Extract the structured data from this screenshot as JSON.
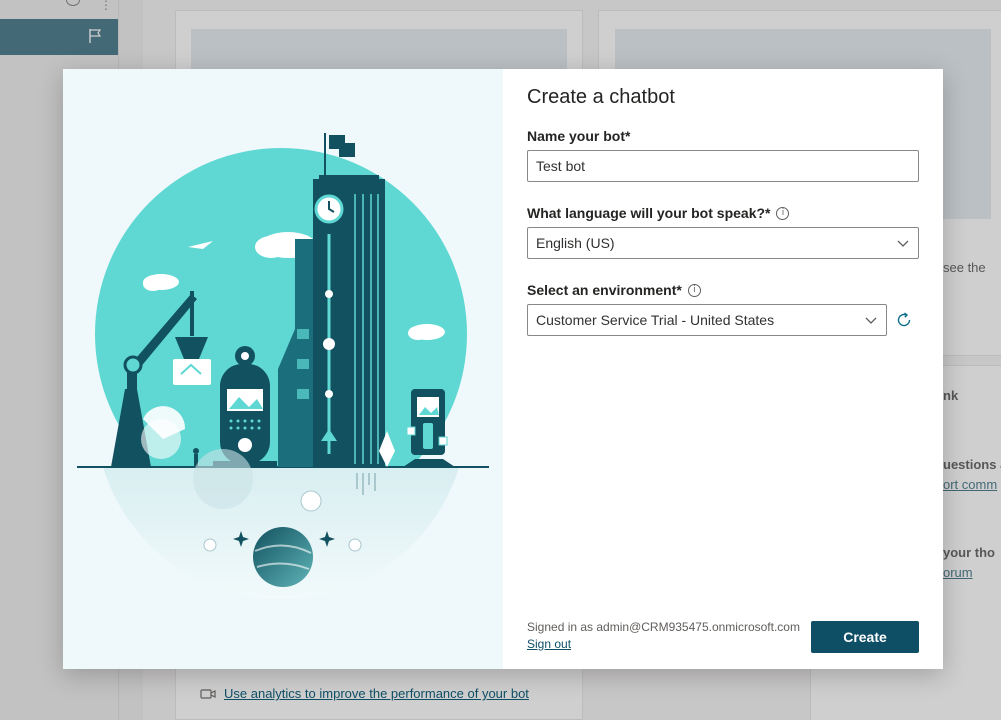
{
  "background": {
    "text_see_the": "see the",
    "text_nk": "nk",
    "text_questions": "uestions a",
    "link_community": "ort comm",
    "text_your_thoughts": "your tho",
    "link_forum": "orum",
    "analytics_link": "Use analytics to improve the performance of your bot"
  },
  "dialog": {
    "title": "Create a chatbot",
    "name_label": "Name your bot*",
    "name_value": "Test bot",
    "language_label": "What language will your bot speak?*",
    "language_value": "English (US)",
    "environment_label": "Select an environment*",
    "environment_value": "Customer Service Trial - United States",
    "signed_in_text": "Signed in as admin@CRM935475.onmicrosoft.com",
    "sign_out": "Sign out",
    "create_label": "Create"
  },
  "icons": {
    "info": "i"
  },
  "colors": {
    "brand": "#0e4f66",
    "illustration_teal": "#5fd8d3",
    "illustration_dark": "#12515f",
    "illustration_bg": "#eff8fb"
  }
}
